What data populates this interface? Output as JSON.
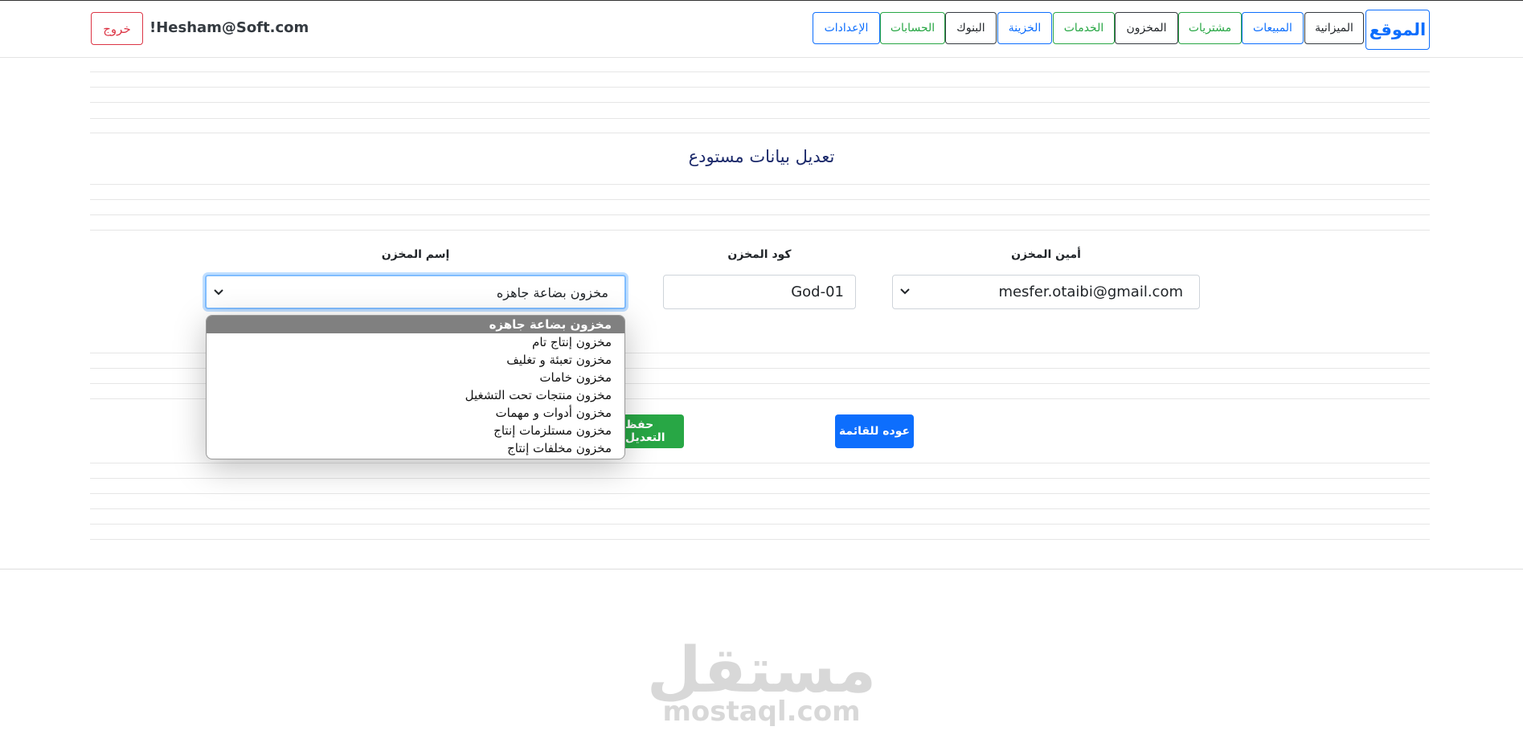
{
  "nav": {
    "brand": "الموقع",
    "items": [
      {
        "label": "الميزانية",
        "color": "#212529"
      },
      {
        "label": "المبيعات",
        "color": "#0d6efd"
      },
      {
        "label": "مشتريات",
        "color": "#28a745"
      },
      {
        "label": "المخزون",
        "color": "#212529"
      },
      {
        "label": "الخدمات",
        "color": "#28a745"
      },
      {
        "label": "الخزينة",
        "color": "#0d6efd"
      },
      {
        "label": "البنوك",
        "color": "#212529"
      },
      {
        "label": "الحسابات",
        "color": "#28a745"
      },
      {
        "label": "الإعدادات",
        "color": "#0d6efd"
      }
    ],
    "user_email": "!Hesham@Soft.com",
    "logout_label": "خروج"
  },
  "page": {
    "title": "تعديل بيانات مستودع"
  },
  "form": {
    "keeper_label": "أمين المخزن",
    "keeper_value": "mesfer.otaibi@gmail.com",
    "code_label": "كود المخزن",
    "code_value": "God-01",
    "name_label": "إسم المخزن",
    "name_value": "مخزون بضاعة جاهزه",
    "name_options": [
      "مخزون بضاعة جاهزه",
      "مخزون إنتاج تام",
      "مخزون تعبئة و تغليف",
      "مخزون خامات",
      "مخزون منتجات تحت التشغيل",
      "مخزون أدوات و مهمات",
      "مخزون مستلزمات إنتاج",
      "مخزون مخلفات إنتاج"
    ]
  },
  "actions": {
    "save_label": "حفظ التعديل",
    "back_label": "عوده للقائمة"
  },
  "watermark": {
    "arabic": "مستقل",
    "latin": "mostaql.com"
  },
  "colors": {
    "primary": "#0d6efd",
    "success": "#28a745",
    "danger": "#dc3545",
    "selected_option_bg": "#808080"
  }
}
